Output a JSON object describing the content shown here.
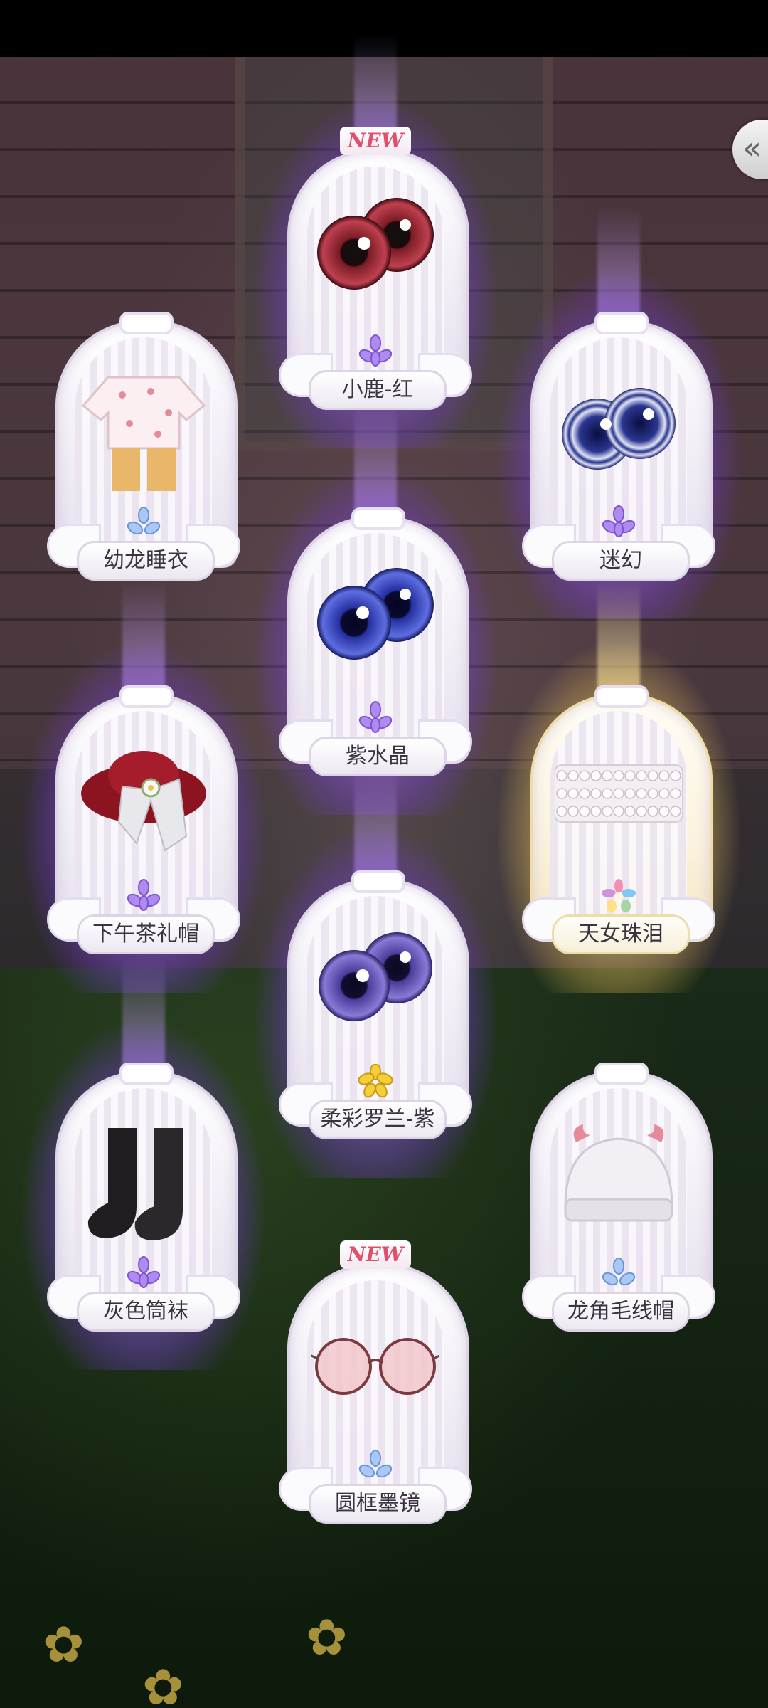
{
  "header": {
    "back_icon": "chevron-left-double-icon",
    "back_glyph": "«"
  },
  "colors": {
    "purple_glow": "#a96eff",
    "gold_glow": "#ffe68c",
    "label_text": "#3b3440",
    "new_badge": "#e0506a"
  },
  "items": [
    {
      "name": "小鹿-红",
      "rarity": "purple",
      "glow": "purple",
      "new_badge": "NEW",
      "icon": "red-eyes-icon"
    },
    {
      "name": "幼龙睡衣",
      "rarity": "blue",
      "glow": "none",
      "new_badge": "",
      "icon": "pajamas-icon"
    },
    {
      "name": "迷幻",
      "rarity": "purple",
      "glow": "purple",
      "new_badge": "",
      "icon": "swirl-eyes-icon"
    },
    {
      "name": "紫水晶",
      "rarity": "purple",
      "glow": "purple",
      "new_badge": "",
      "icon": "blue-eyes-icon"
    },
    {
      "name": "下午茶礼帽",
      "rarity": "purple",
      "glow": "purple",
      "new_badge": "",
      "icon": "tea-hat-icon"
    },
    {
      "name": "天女珠泪",
      "rarity": "rainbow",
      "glow": "gold",
      "new_badge": "",
      "icon": "pearl-necklace-icon"
    },
    {
      "name": "柔彩罗兰-紫",
      "rarity": "gold",
      "glow": "purple",
      "new_badge": "",
      "icon": "violet-eyes-icon"
    },
    {
      "name": "灰色筒袜",
      "rarity": "purple",
      "glow": "purple",
      "new_badge": "",
      "icon": "black-socks-icon"
    },
    {
      "name": "龙角毛线帽",
      "rarity": "blue",
      "glow": "none",
      "new_badge": "",
      "icon": "dragon-horn-beanie-icon"
    },
    {
      "name": "圆框墨镜",
      "rarity": "blue",
      "glow": "none",
      "new_badge": "NEW",
      "icon": "round-sunglasses-icon"
    }
  ]
}
